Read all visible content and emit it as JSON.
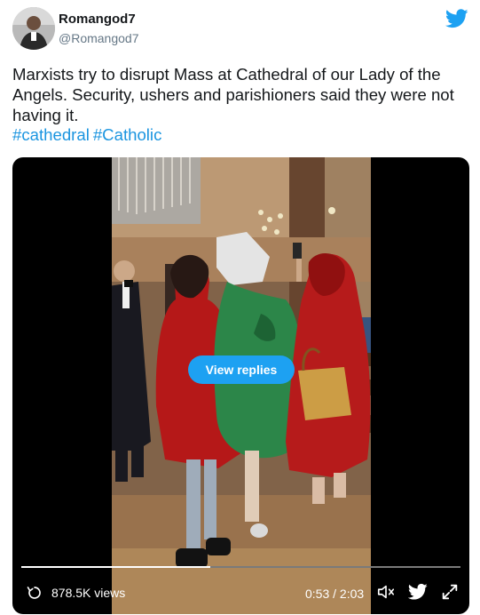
{
  "author": {
    "name": "Romangod7",
    "handle": "@Romangod7"
  },
  "tweet": {
    "text": "Marxists try to disrupt Mass at Cathedral of our Lady of the Angels.  Security, ushers and parishioners said they were not having it.",
    "hashtags": [
      "#cathedral",
      "#Catholic"
    ]
  },
  "video": {
    "view_replies_label": "View replies",
    "views": "878.5K views",
    "time": "0:53 / 2:03",
    "progress": 0.43
  },
  "icons": {
    "brand": "twitter-bird-icon",
    "views": "replay-icon",
    "volume": "volume-icon",
    "share": "twitter-bird-icon",
    "fullscreen": "expand-icon"
  },
  "colors": {
    "accent": "#1da1f2",
    "hashtag": "#1b95e0",
    "video_bg": "#000000"
  }
}
